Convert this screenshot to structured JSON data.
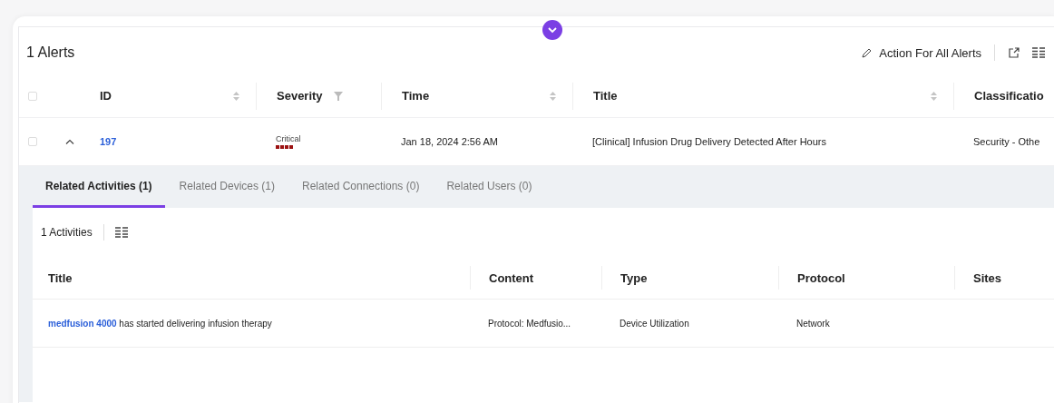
{
  "header": {
    "title": "1 Alerts",
    "action_label": "Action For All Alerts"
  },
  "table": {
    "all_checked": false,
    "columns": [
      {
        "label": "ID",
        "kind": "sort"
      },
      {
        "label": "Severity",
        "kind": "filter"
      },
      {
        "label": "Time",
        "kind": "sort"
      },
      {
        "label": "Title",
        "kind": "sort"
      },
      {
        "label": "Classificatio",
        "kind": "plain"
      }
    ],
    "rows": [
      {
        "checked": false,
        "expanded": true,
        "id": "197",
        "severity": {
          "label": "Critical",
          "level": 1,
          "color": "#9b1111"
        },
        "time": "Jan 18, 2024 2:56 AM",
        "title": "[Clinical] Infusion Drug Delivery Detected After Hours",
        "classification": "Security - Othe"
      }
    ]
  },
  "tabs": [
    {
      "label": "Related Activities (1)",
      "selected": true
    },
    {
      "label": "Related Devices (1)",
      "selected": false
    },
    {
      "label": "Related Connections (0)",
      "selected": false
    },
    {
      "label": "Related Users (0)",
      "selected": false
    }
  ],
  "activities": {
    "count": "1 Activities",
    "columns": [
      "Title",
      "Content",
      "Type",
      "Protocol",
      "Sites"
    ],
    "rows": [
      {
        "device": "medfusion 4000",
        "text": "has started delivering infusion therapy",
        "content": "Protocol: Medfusio...",
        "type": "Device Utilization",
        "protocol": "Network"
      }
    ]
  }
}
